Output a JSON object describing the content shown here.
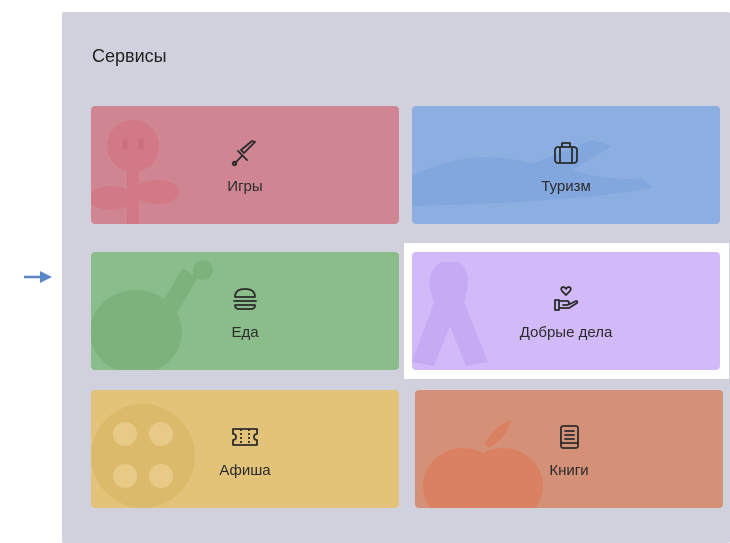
{
  "panel": {
    "title": "Сервисы"
  },
  "tiles": [
    {
      "label": "Игры",
      "icon": "sword-icon",
      "color": "#cf8592"
    },
    {
      "label": "Туризм",
      "icon": "suitcase-icon",
      "color": "#8caee0"
    },
    {
      "label": "Еда",
      "icon": "burger-icon",
      "color": "#8bbd8b"
    },
    {
      "label": "Добрые дела",
      "icon": "heart-hand-icon",
      "color": "#d2b9f7"
    },
    {
      "label": "Афиша",
      "icon": "ticket-icon",
      "color": "#e2c379"
    },
    {
      "label": "Книги",
      "icon": "book-icon",
      "color": "#d59078"
    }
  ],
  "colors": {
    "panel_bg": "#d0d1dd",
    "arrow": "#5b86c9",
    "highlight": "#ffffff"
  }
}
